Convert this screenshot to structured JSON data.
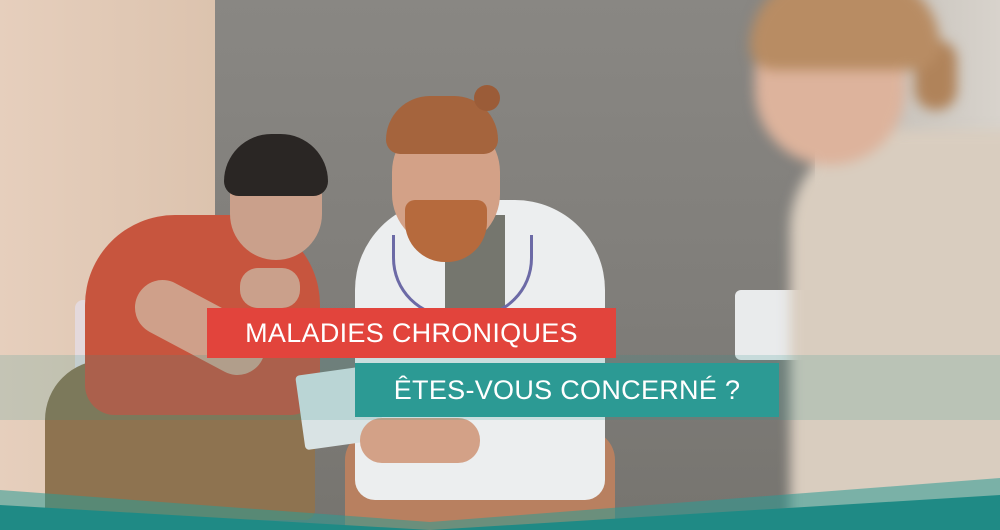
{
  "banner": {
    "line1": "MALADIES CHRONIQUES",
    "line2": "ÊTES-VOUS CONCERNÉ ?"
  },
  "colors": {
    "red": "#e2443c",
    "teal": "#2c9a94",
    "text": "#ffffff"
  },
  "photo": {
    "icon": "medical-consultation-photo"
  }
}
